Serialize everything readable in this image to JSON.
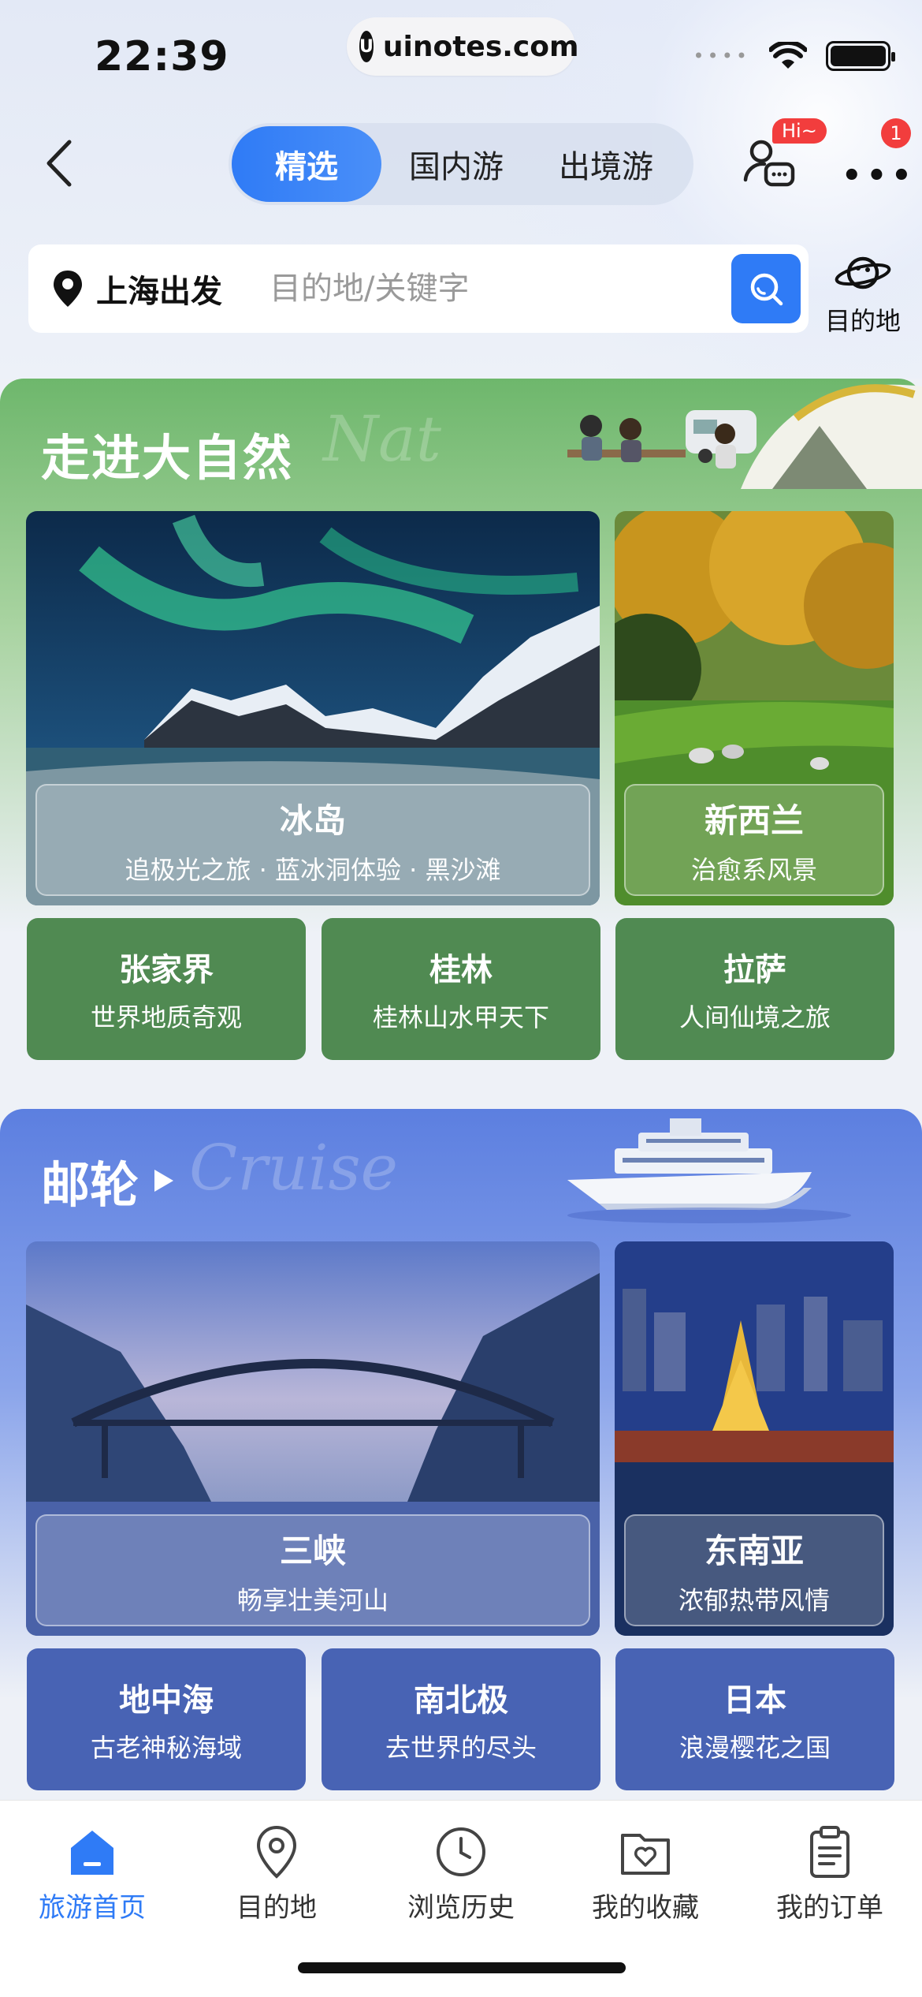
{
  "status_bar": {
    "time": "22:39",
    "url": "uinotes.com"
  },
  "header": {
    "tabs": [
      {
        "label": "精选",
        "active": true
      },
      {
        "label": "国内游",
        "active": false
      },
      {
        "label": "出境游",
        "active": false
      }
    ],
    "hi_badge": "Hi~",
    "more_badge": "1"
  },
  "search": {
    "departure": "上海出发",
    "placeholder": "目的地/关键字",
    "destination_label": "目的地"
  },
  "nature": {
    "title": "走进大自然",
    "watermark": "Nat",
    "featured": [
      {
        "title": "冰岛",
        "subtitle": "追极光之旅 · 蓝冰洞体验 · 黑沙滩"
      },
      {
        "title": "新西兰",
        "subtitle": "治愈系风景"
      }
    ],
    "tiles": [
      {
        "title": "张家界",
        "subtitle": "世界地质奇观"
      },
      {
        "title": "桂林",
        "subtitle": "桂林山水甲天下"
      },
      {
        "title": "拉萨",
        "subtitle": "人间仙境之旅"
      }
    ]
  },
  "cruise": {
    "title": "邮轮",
    "watermark": "Cruise",
    "featured": [
      {
        "title": "三峡",
        "subtitle": "畅享壮美河山"
      },
      {
        "title": "东南亚",
        "subtitle": "浓郁热带风情"
      }
    ],
    "tiles": [
      {
        "title": "地中海",
        "subtitle": "古老神秘海域"
      },
      {
        "title": "南北极",
        "subtitle": "去世界的尽头"
      },
      {
        "title": "日本",
        "subtitle": "浪漫樱花之国"
      }
    ]
  },
  "tabbar": {
    "items": [
      {
        "label": "旅游首页",
        "icon": "home-icon",
        "active": true
      },
      {
        "label": "目的地",
        "icon": "location-pin-icon",
        "active": false
      },
      {
        "label": "浏览历史",
        "icon": "clock-icon",
        "active": false
      },
      {
        "label": "我的收藏",
        "icon": "heart-folder-icon",
        "active": false
      },
      {
        "label": "我的订单",
        "icon": "clipboard-icon",
        "active": false
      }
    ]
  },
  "colors": {
    "accent": "#2f7bf6",
    "nature_green": "#508a52",
    "cruise_blue": "#4863b4",
    "badge_red": "#f23d3d"
  }
}
